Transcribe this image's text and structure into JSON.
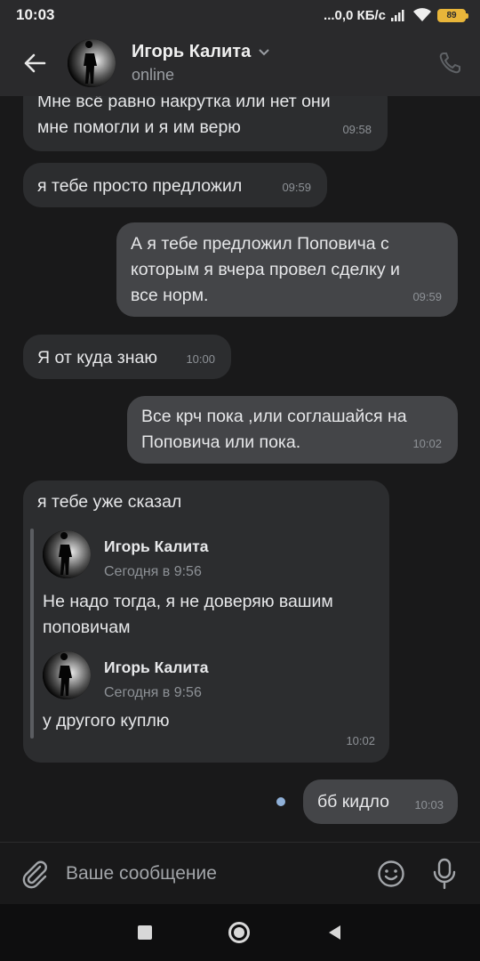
{
  "status_bar": {
    "time": "10:03",
    "network": "...0,0 КБ/с",
    "battery": "89"
  },
  "header": {
    "name": "Игорь Калита",
    "status": "online"
  },
  "messages": [
    {
      "dir": "in",
      "lines": [
        "Мне всё равно накрутка или нет они",
        "мне помогли и я им верю"
      ],
      "time": "09:58"
    },
    {
      "dir": "in",
      "lines": [
        "я тебе просто предложил"
      ],
      "time": "09:59"
    },
    {
      "dir": "out",
      "lines": [
        "А я тебе предложил Поповича с",
        "которым я вчера провел сделку и",
        "все норм."
      ],
      "time": "09:59"
    },
    {
      "dir": "in",
      "lines": [
        "Я от куда знаю"
      ],
      "time": "10:00"
    },
    {
      "dir": "out",
      "lines": [
        "Все крч пока ,или соглашайся на",
        "Поповича или пока."
      ],
      "time": "10:02"
    },
    {
      "dir": "in",
      "text": "я тебе уже сказал",
      "time": "10:02",
      "forwarded": [
        {
          "name": "Игорь Калита",
          "date": "Сегодня в 9:56",
          "lines": [
            "Не надо тогда, я не доверяю вашим",
            "поповичам"
          ]
        },
        {
          "name": "Игорь Калита",
          "date": "Сегодня в 9:56",
          "lines": [
            "у другого куплю"
          ]
        }
      ]
    },
    {
      "dir": "out",
      "lines": [
        "бб кидло"
      ],
      "time": "10:03",
      "unread": true
    }
  ],
  "composer": {
    "placeholder": "Ваше сообщение"
  },
  "icons": {
    "back": "arrow-left-icon",
    "call": "phone-icon",
    "attach": "paperclip-icon",
    "emoji": "smile-icon",
    "mic": "microphone-icon"
  }
}
